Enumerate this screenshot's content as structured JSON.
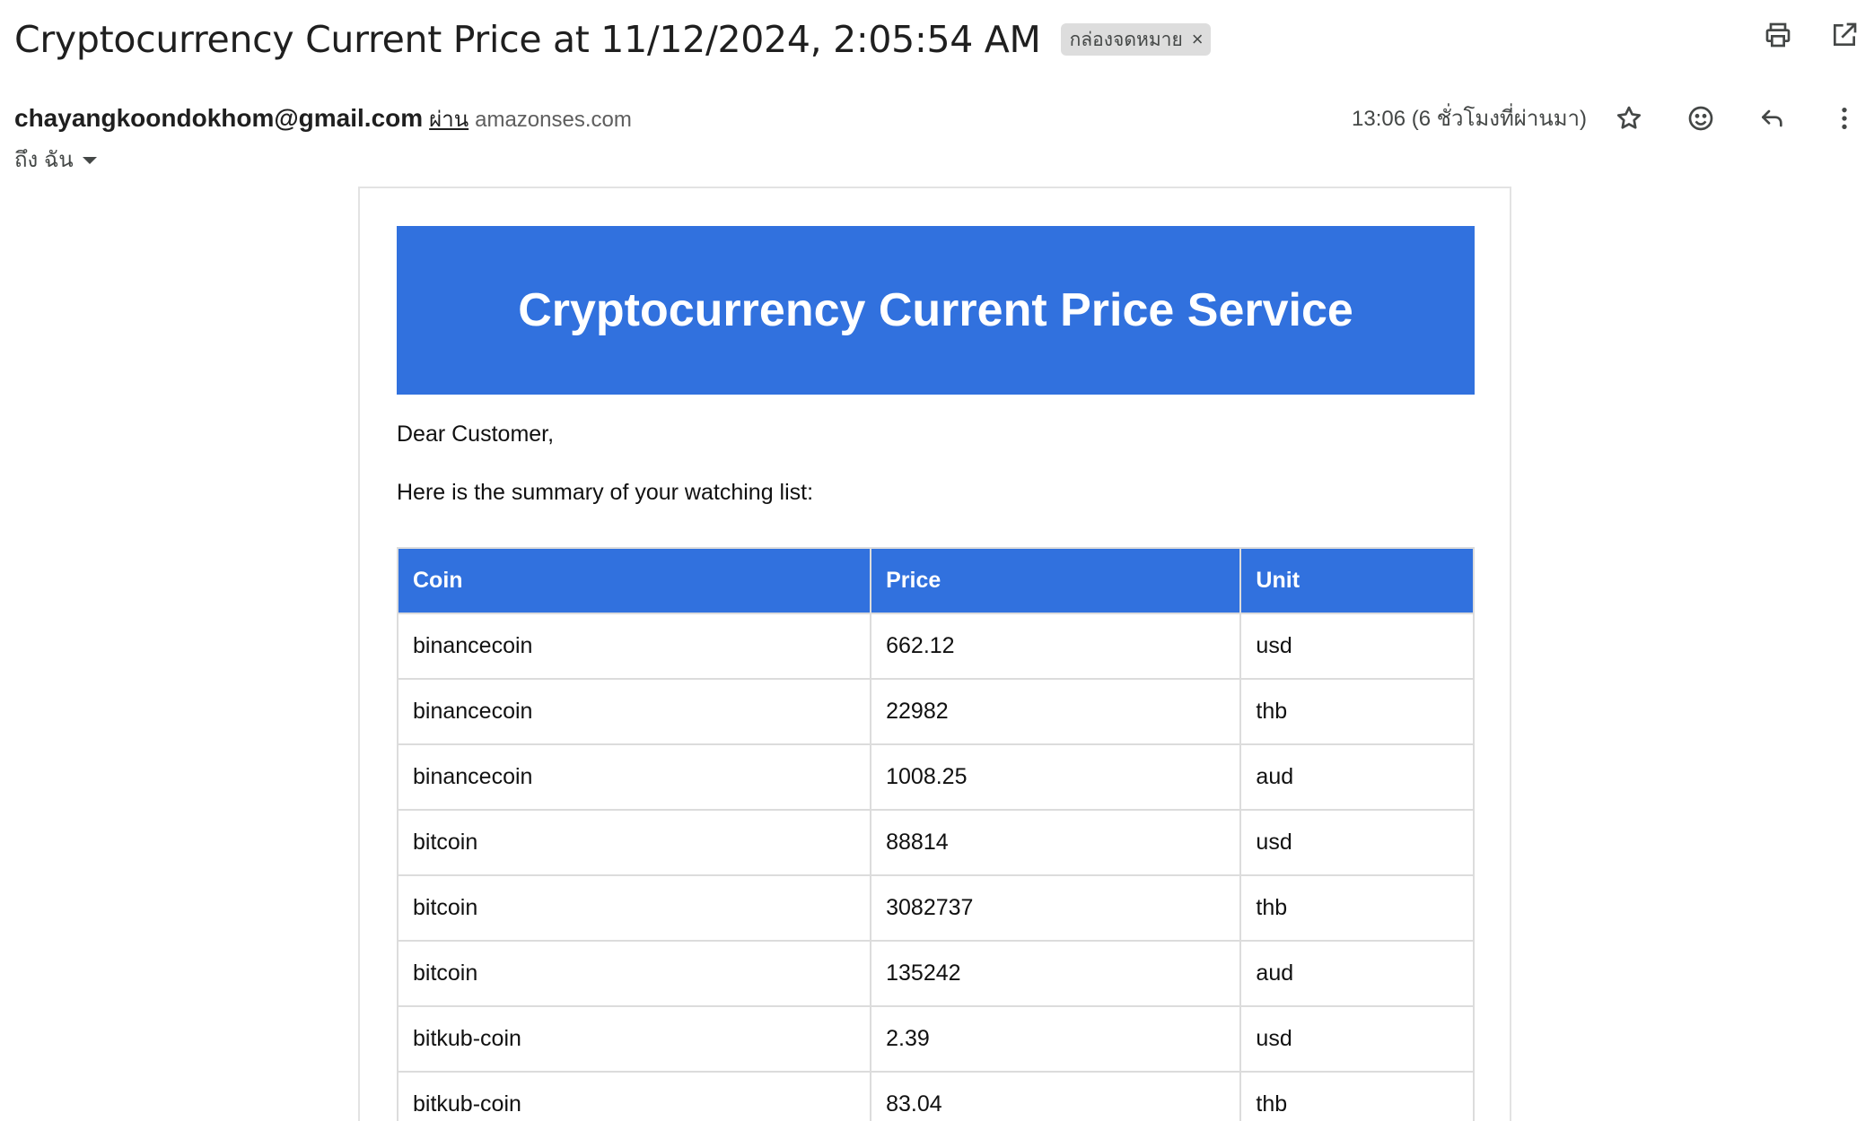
{
  "header": {
    "subject": "Cryptocurrency Current Price at 11/12/2024, 2:05:54 AM",
    "label_chip": "กล่องจดหมาย",
    "chip_close": "×"
  },
  "sender": {
    "email": "chayangkoondokhom@gmail.com",
    "via_label": "ผ่าน",
    "via_domain": "amazonses.com",
    "to_label": "ถึง ฉัน",
    "timestamp": "13:06 (6 ชั่วโมงที่ผ่านมา)"
  },
  "icons": {
    "top": [
      "printer-icon",
      "open-in-new-window-icon"
    ],
    "meta": [
      "star-icon",
      "emoji-icon",
      "reply-icon",
      "more-vert-icon"
    ]
  },
  "email": {
    "banner_title": "Cryptocurrency Current Price Service",
    "greeting": "Dear Customer,",
    "intro": "Here is the summary of your watching list:",
    "table": {
      "headers": [
        "Coin",
        "Price",
        "Unit"
      ],
      "rows": [
        [
          "binancecoin",
          "662.12",
          "usd"
        ],
        [
          "binancecoin",
          "22982",
          "thb"
        ],
        [
          "binancecoin",
          "1008.25",
          "aud"
        ],
        [
          "bitcoin",
          "88814",
          "usd"
        ],
        [
          "bitcoin",
          "3082737",
          "thb"
        ],
        [
          "bitcoin",
          "135242",
          "aud"
        ],
        [
          "bitkub-coin",
          "2.39",
          "usd"
        ],
        [
          "bitkub-coin",
          "83.04",
          "thb"
        ]
      ]
    }
  },
  "colors": {
    "banner_blue": "#3171de",
    "table_border": "#dcdcdc",
    "chip_bg": "#dddddd"
  }
}
